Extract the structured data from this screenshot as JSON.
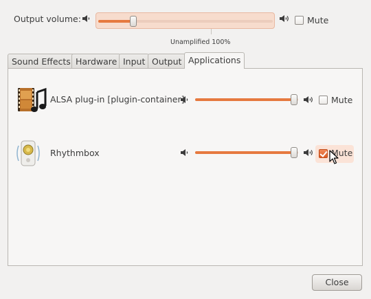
{
  "header": {
    "output_volume_label": "Output volume:",
    "output_volume_fraction": 0.2,
    "amplification_caption": "Unamplified 100%",
    "mute_label": "Mute",
    "muted": false
  },
  "tabs": [
    {
      "label": "Sound Effects",
      "active": false
    },
    {
      "label": "Hardware",
      "active": false
    },
    {
      "label": "Input",
      "active": false
    },
    {
      "label": "Output",
      "active": false
    },
    {
      "label": "Applications",
      "active": true
    }
  ],
  "applications": [
    {
      "name": "ALSA plug-in [plugin-container]",
      "icon": "film-music-icon",
      "volume_fraction": 1.0,
      "mute_label": "Mute",
      "muted": false
    },
    {
      "name": "Rhythmbox",
      "icon": "rhythmbox-speaker-icon",
      "volume_fraction": 1.0,
      "mute_label": "Mute",
      "muted": true
    }
  ],
  "footer": {
    "close_label": "Close"
  },
  "colors": {
    "accent": "#e6793f",
    "window_bg": "#f2f1f0",
    "panel_bg": "#f7f6f5"
  }
}
